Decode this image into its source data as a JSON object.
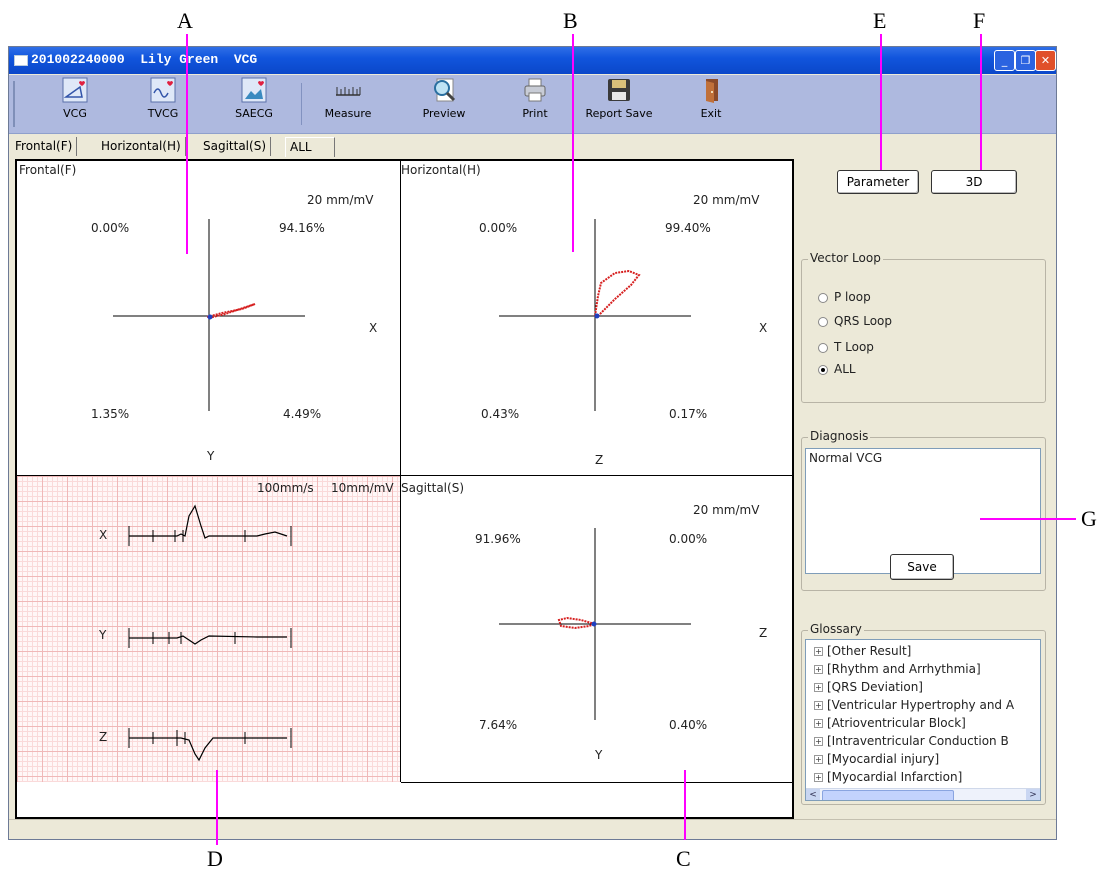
{
  "callouts": {
    "A": "A",
    "B": "B",
    "C": "C",
    "D": "D",
    "E": "E",
    "F": "F",
    "G": "G"
  },
  "window": {
    "title": "201002240000  Lily Green  VCG",
    "controls": {
      "minimize": "_",
      "restore": "❐",
      "close": "✕"
    }
  },
  "toolbar": {
    "items": [
      {
        "label": "VCG",
        "icon": "vcg-icon"
      },
      {
        "label": "TVCG",
        "icon": "tvcg-icon"
      },
      {
        "label": "SAECG",
        "icon": "saecg-icon"
      },
      {
        "label": "Measure",
        "icon": "ruler-icon"
      },
      {
        "label": "Preview",
        "icon": "magnifier-icon"
      },
      {
        "label": "Print",
        "icon": "printer-icon"
      },
      {
        "label": "Report Save",
        "icon": "floppy-disk-icon"
      },
      {
        "label": "Exit",
        "icon": "exit-door-icon"
      }
    ]
  },
  "tabs": [
    "Frontal(F)",
    "Horizontal(H)",
    "Sagittal(S)",
    "ALL"
  ],
  "frontal": {
    "title": "Frontal(F)",
    "scale": "20 mm/mV",
    "q_top_left": "0.00%",
    "q_top_right": "94.16%",
    "q_bottom_left": "1.35%",
    "q_bottom_right": "4.49%",
    "x_axis": "X",
    "y_axis": "Y"
  },
  "horizontal": {
    "title": "Horizontal(H)",
    "scale": "20 mm/mV",
    "q_top_left": "0.00%",
    "q_top_right": "99.40%",
    "q_bottom_left": "0.43%",
    "q_bottom_right": "0.17%",
    "x_axis": "X",
    "z_axis": "Z"
  },
  "ecg": {
    "speed": "100mm/s",
    "gain": "10mm/mV",
    "leads": [
      "X",
      "Y",
      "Z"
    ]
  },
  "sagittal": {
    "title": "Sagittal(S)",
    "scale": "20 mm/mV",
    "q_top_left": "91.96%",
    "q_top_right": "0.00%",
    "q_bottom_left": "7.64%",
    "q_bottom_right": "0.40%",
    "z_axis": "Z",
    "y_axis": "Y"
  },
  "side": {
    "parameter_button": "Parameter",
    "threeD_button": "3D",
    "vector_loop": {
      "title": "Vector Loop",
      "options": [
        "P loop",
        "QRS Loop",
        "T Loop",
        "ALL"
      ],
      "selected": "ALL"
    },
    "diagnosis": {
      "title": "Diagnosis",
      "text": "Normal VCG",
      "save_button": "Save"
    },
    "glossary": {
      "title": "Glossary",
      "items": [
        "[Other Result]",
        "[Rhythm and Arrhythmia]",
        "[QRS Deviation]",
        "[Ventricular Hypertrophy and A",
        "[Atrioventricular Block]",
        "[Intraventricular Conduction B",
        "[Myocardial injury]",
        "[Myocardial Infarction]"
      ],
      "scroll_left": "<",
      "scroll_right": ">"
    }
  },
  "colors": {
    "loop": "#d62020",
    "loop_start": "#1f3fbf",
    "callout_line": "#ff00ff",
    "toolbar": "#aeb9df",
    "titlebar": "#0b47c9"
  }
}
